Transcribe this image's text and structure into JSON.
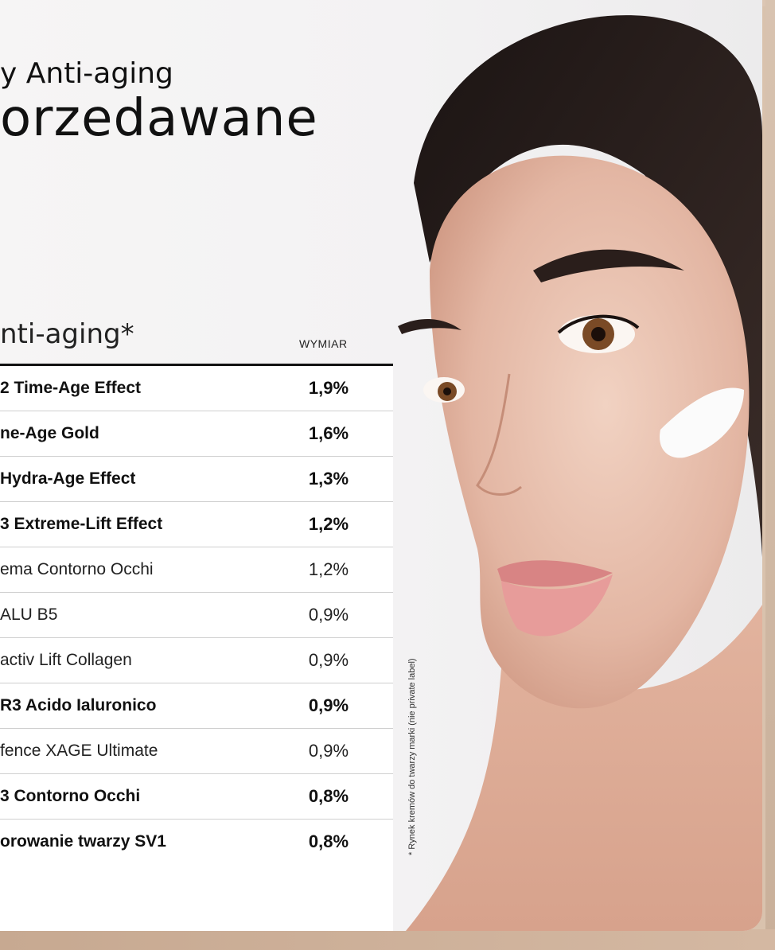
{
  "header": {
    "kicker": "y Anti-aging",
    "headline": "orzedawane"
  },
  "table": {
    "title": "nti-aging*",
    "column_header": "WYMIAR",
    "rows": [
      {
        "name": "2 Time-Age Effect",
        "value": "1,9%",
        "bold": true
      },
      {
        "name": "ne-Age Gold",
        "value": "1,6%",
        "bold": true
      },
      {
        "name": " Hydra-Age Effect",
        "value": "1,3%",
        "bold": true
      },
      {
        "name": "3 Extreme-Lift Effect",
        "value": "1,2%",
        "bold": true
      },
      {
        "name": "ema Contorno Occhi",
        "value": "1,2%",
        "bold": false
      },
      {
        "name": "ALU B5",
        "value": "0,9%",
        "bold": false
      },
      {
        "name": "activ Lift Collagen",
        "value": "0,9%",
        "bold": false
      },
      {
        "name": "R3 Acido Ialuronico",
        "value": "0,9%",
        "bold": true
      },
      {
        "name": "fence XAGE Ultimate",
        "value": "0,9%",
        "bold": false
      },
      {
        "name": "3 Contorno Occhi",
        "value": "0,8%",
        "bold": true
      },
      {
        "name": "orowanie twarzy SV1",
        "value": "0,8%",
        "bold": true
      }
    ]
  },
  "footnote": "* Rynek kremów do twarzy marki (nie private label)",
  "colors": {
    "page_background": "#f4f3f4",
    "frame": "#d4bca7",
    "text": "#111111",
    "rule": "#111111"
  }
}
